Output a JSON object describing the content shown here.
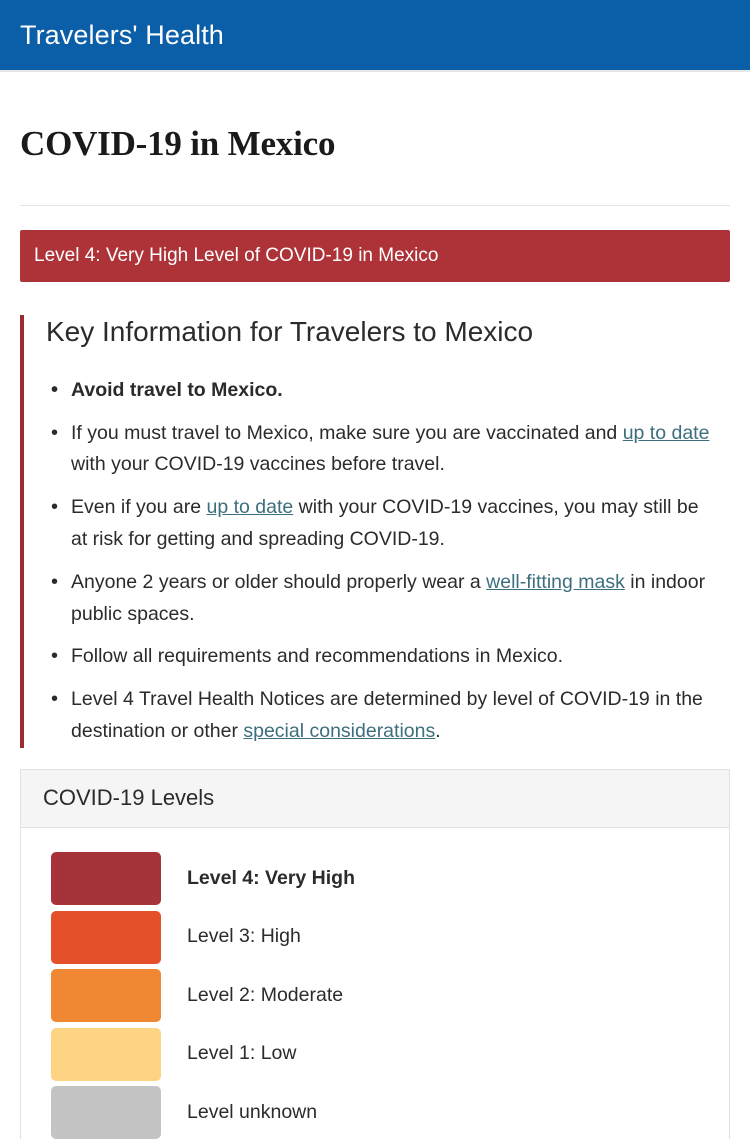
{
  "header": {
    "title": "Travelers' Health",
    "background_color": "#0b5ea8"
  },
  "page": {
    "title": "COVID-19 in Mexico"
  },
  "level_banner": {
    "text": "Level 4: Very High Level of COVID-19 in Mexico",
    "background_color": "#ae3339",
    "text_color": "#ffffff"
  },
  "key_info": {
    "heading": "Key Information for Travelers to Mexico",
    "accent_color": "#9b2c33",
    "link_color": "#3d6e7e",
    "bullets": [
      {
        "bold": true,
        "parts": [
          {
            "type": "text",
            "text": "Avoid travel to Mexico."
          }
        ]
      },
      {
        "bold": false,
        "parts": [
          {
            "type": "text",
            "text": "If you must travel to Mexico, make sure you are vaccinated and "
          },
          {
            "type": "link",
            "text": "up to date"
          },
          {
            "type": "text",
            "text": " with your COVID-19 vaccines before travel."
          }
        ]
      },
      {
        "bold": false,
        "parts": [
          {
            "type": "text",
            "text": "Even if you are "
          },
          {
            "type": "link",
            "text": "up to date"
          },
          {
            "type": "text",
            "text": " with your COVID-19 vaccines, you may still be at risk for getting and spreading COVID-19."
          }
        ]
      },
      {
        "bold": false,
        "parts": [
          {
            "type": "text",
            "text": "Anyone 2 years or older should properly wear a "
          },
          {
            "type": "link",
            "text": "well-fitting mask"
          },
          {
            "type": "text",
            "text": " in indoor public spaces."
          }
        ]
      },
      {
        "bold": false,
        "parts": [
          {
            "type": "text",
            "text": "Follow all requirements and recommendations in Mexico."
          }
        ]
      },
      {
        "bold": false,
        "parts": [
          {
            "type": "text",
            "text": "Level 4 Travel Health Notices are determined by level of COVID-19 in the destination or other "
          },
          {
            "type": "link",
            "text": "special considerations"
          },
          {
            "type": "text",
            "text": "."
          }
        ]
      }
    ]
  },
  "levels_card": {
    "title": "COVID-19 Levels",
    "rows": [
      {
        "label": "Level 4: Very High",
        "color": "#a63339",
        "current": true
      },
      {
        "label": "Level 3: High",
        "color": "#e4502a",
        "current": false
      },
      {
        "label": "Level 2: Moderate",
        "color": "#ef8733",
        "current": false
      },
      {
        "label": "Level 1: Low",
        "color": "#fcd483",
        "current": false
      },
      {
        "label": "Level unknown",
        "color": "#c4c4c4",
        "current": false
      }
    ]
  }
}
